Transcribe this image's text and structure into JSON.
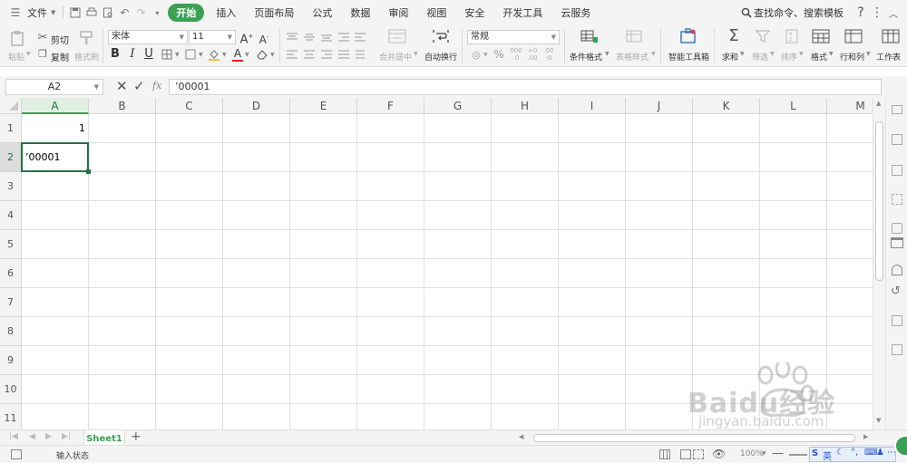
{
  "menubar": {
    "file_label": "文件",
    "tabs": [
      {
        "label": "开始",
        "active": true
      },
      {
        "label": "插入"
      },
      {
        "label": "页面布局"
      },
      {
        "label": "公式"
      },
      {
        "label": "数据"
      },
      {
        "label": "审阅"
      },
      {
        "label": "视图"
      },
      {
        "label": "安全"
      },
      {
        "label": "开发工具"
      },
      {
        "label": "云服务"
      }
    ],
    "search_label": "查找命令、搜索模板",
    "accent_color": "#3aa053"
  },
  "toolbar": {
    "paste": "粘贴",
    "cut": "剪切",
    "copy": "复制",
    "format_painter": "格式刷",
    "font_name": "宋体",
    "font_size": "11",
    "bold": "B",
    "italic": "I",
    "underline": "U",
    "merge_center": "合并居中",
    "wrap_text": "自动换行",
    "number_format": "常规",
    "percent": "%",
    "cond_format": "条件格式",
    "table_style": "表格样式",
    "smart_toolbox": "智能工具箱",
    "sum": "求和",
    "filter": "筛选",
    "sort": "排序",
    "format": "格式",
    "row_col": "行和列",
    "worksheet": "工作表"
  },
  "formula_bar": {
    "name_box": "A2",
    "fx_label": "fx",
    "formula": "’00001"
  },
  "grid": {
    "columns": [
      "A",
      "B",
      "C",
      "D",
      "E",
      "F",
      "G",
      "H",
      "I",
      "J",
      "K",
      "L",
      "M"
    ],
    "rows": [
      "1",
      "2",
      "3",
      "4",
      "5",
      "6",
      "7",
      "8",
      "9",
      "10",
      "11"
    ],
    "selected_cell": "A2",
    "cells": [
      {
        "ref": "A1",
        "value": "1",
        "align": "right"
      },
      {
        "ref": "A2",
        "value": "’00001",
        "align": "left"
      }
    ]
  },
  "sheets": {
    "tabs": [
      {
        "label": "Sheet1",
        "active": true
      }
    ],
    "add_label": "+"
  },
  "statusbar": {
    "mode": "输入状态",
    "zoom": "100%",
    "ime": "英"
  },
  "watermark": {
    "brand": "Baidu经验",
    "url": "jingyan.baidu.com"
  }
}
